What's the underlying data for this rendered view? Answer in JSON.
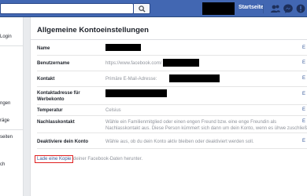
{
  "topbar": {
    "search": {
      "placeholder": "",
      "value": ""
    },
    "home_label": "Startseite",
    "icons": [
      "friends-icon",
      "messages-icon",
      "notifications-icon"
    ]
  },
  "sidebar": {
    "items": [
      {
        "label": "Login"
      },
      {
        "label": "ngen"
      },
      {
        "label": "räge"
      },
      {
        "label": "seiten"
      },
      {
        "label": "ch"
      }
    ]
  },
  "settings": {
    "title": "Allgemeine Kontoeinstellungen",
    "edit_label": "E",
    "rows": [
      {
        "label": "Name",
        "value": ""
      },
      {
        "label": "Benutzername",
        "value": "https://www.facebook.com/"
      },
      {
        "label": "Kontakt",
        "value": "Primäre E-Mail-Adresse:"
      },
      {
        "label": "Kontaktadresse für Werbekonto",
        "value": ""
      },
      {
        "label": "Temperatur",
        "value": "Celsius"
      },
      {
        "label": "Nachlasskontakt",
        "value": "Wähle ein Familienmitglied oder einen engen Freund bzw. eine enge Freundin als",
        "value2": "Nachlasskontakt aus. Diese Person kümmert sich dann um dein Konto, wenn es ühwe zuschließen"
      },
      {
        "label": "Deaktiviere dein Konto",
        "value": "Wähle aus, ob du dein Konto aktiv bleiben oder deaktiviert werden soll."
      }
    ],
    "download_link": "Lade eine Kopie",
    "download_text": "deiner Facebook-Daten herunter."
  },
  "colors": {
    "brand": "#4267b2",
    "link": "#365899",
    "highlight": "#e02020"
  }
}
